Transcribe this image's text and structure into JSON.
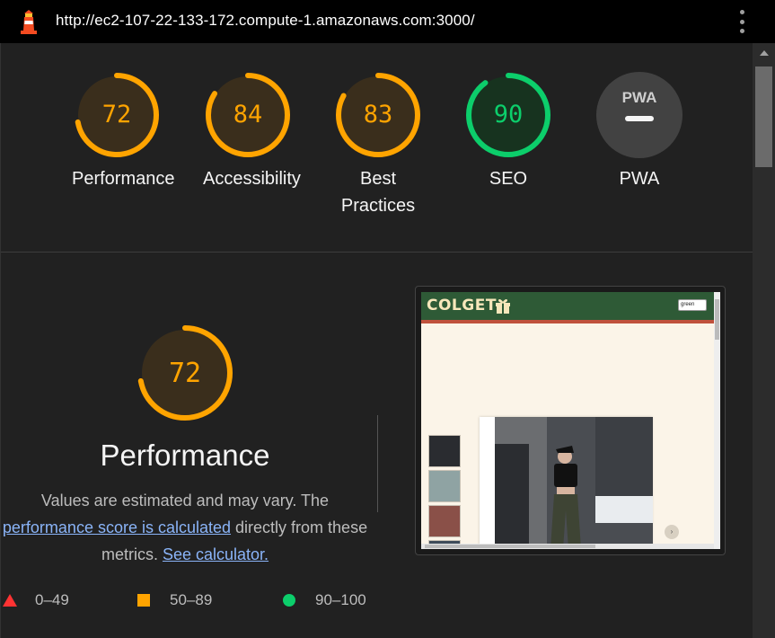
{
  "titlebar": {
    "url": "http://ec2-107-22-133-172.compute-1.amazonaws.com:3000/"
  },
  "colors": {
    "average": "#ffa400",
    "pass": "#0cce6b",
    "fail": "#ff3333",
    "gauge_track_average": "#3a2e1c",
    "gauge_track_pass": "#17331f",
    "link": "#8ab4f8"
  },
  "gauges": [
    {
      "label": "Performance",
      "value": "72",
      "score": 0.72,
      "status": "average"
    },
    {
      "label": "Accessibility",
      "value": "84",
      "score": 0.84,
      "status": "average"
    },
    {
      "label_line1": "Best",
      "label_line2": "Practices",
      "value": "83",
      "score": 0.83,
      "status": "average"
    },
    {
      "label": "SEO",
      "value": "90",
      "score": 0.9,
      "status": "pass"
    },
    {
      "label": "PWA",
      "badge": "PWA",
      "status": "na"
    }
  ],
  "performance": {
    "score": "72",
    "score_fraction": 0.72,
    "title": "Performance",
    "desc_text1": "Values are estimated and may vary. The",
    "desc_link1": "performance score is calculated",
    "desc_text2": " directly from these",
    "desc_text3": "metrics. ",
    "desc_link2": "See calculator."
  },
  "legend": [
    {
      "icon": "triangle-icon",
      "range": "0–49"
    },
    {
      "icon": "square-icon",
      "range": "50–89"
    },
    {
      "icon": "circle-icon",
      "range": "90–100"
    }
  ],
  "screenshot": {
    "site_logo": "COLGET",
    "theme_select": "green"
  }
}
